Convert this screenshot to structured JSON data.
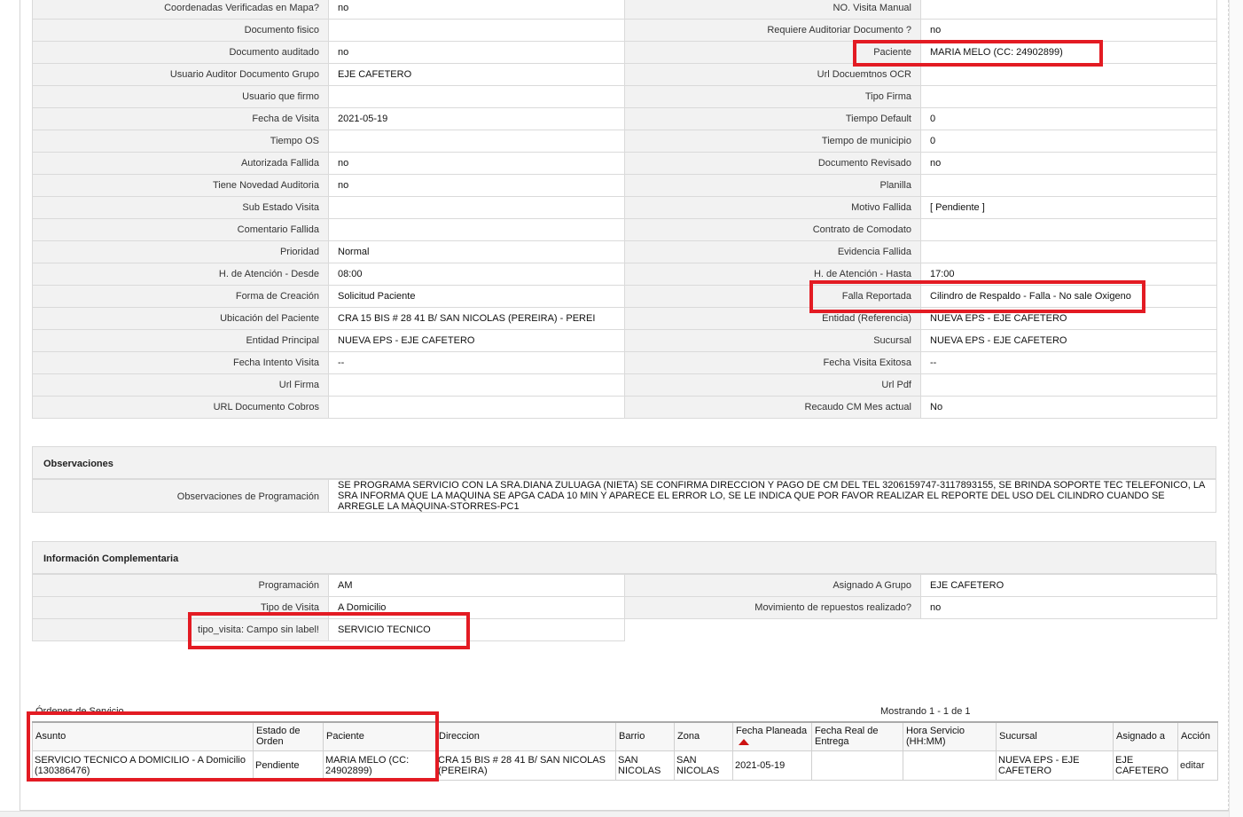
{
  "colors": {
    "highlight": "#e31b23",
    "label_bg": "#f2f2f2",
    "border": "#dadada"
  },
  "details": {
    "rows": [
      {
        "l1": "Coordenadas Verificadas en Mapa?",
        "v1": "no",
        "l2": "NO. Visita Manual",
        "v2": ""
      },
      {
        "l1": "Documento fisico",
        "v1": "",
        "l2": "Requiere Auditoriar Documento ?",
        "v2": "no"
      },
      {
        "l1": "Documento auditado",
        "v1": "no",
        "l2": "Paciente",
        "v2": "MARIA MELO (CC: 24902899)"
      },
      {
        "l1": "Usuario Auditor Documento Grupo",
        "v1": "EJE CAFETERO",
        "l2": "Url Docuemtnos OCR",
        "v2": ""
      },
      {
        "l1": "Usuario que firmo",
        "v1": "",
        "l2": "Tipo Firma",
        "v2": ""
      },
      {
        "l1": "Fecha de Visita",
        "v1": "2021-05-19",
        "l2": "Tiempo Default",
        "v2": "0"
      },
      {
        "l1": "Tiempo OS",
        "v1": "",
        "l2": "Tiempo de municipio",
        "v2": "0"
      },
      {
        "l1": "Autorizada Fallida",
        "v1": "no",
        "l2": "Documento Revisado",
        "v2": "no"
      },
      {
        "l1": "Tiene Novedad Auditoria",
        "v1": "no",
        "l2": "Planilla",
        "v2": ""
      },
      {
        "l1": "Sub Estado Visita",
        "v1": "",
        "l2": "Motivo Fallida",
        "v2": "[ Pendiente ]"
      },
      {
        "l1": "Comentario Fallida",
        "v1": "",
        "l2": "Contrato de Comodato",
        "v2": ""
      },
      {
        "l1": "Prioridad",
        "v1": "Normal",
        "l2": "Evidencia Fallida",
        "v2": ""
      },
      {
        "l1": "H. de Atención - Desde",
        "v1": "08:00",
        "l2": "H. de Atención - Hasta",
        "v2": "17:00"
      },
      {
        "l1": "Forma de Creación",
        "v1": "Solicitud Paciente",
        "l2": "Falla Reportada",
        "v2": "Cilindro de Respaldo - Falla - No sale Oxigeno"
      },
      {
        "l1": "Ubicación del Paciente",
        "v1": "CRA 15 BIS # 28 41 B/ SAN NICOLAS (PEREIRA) - PEREI",
        "l2": "Entidad (Referencia)",
        "v2": "NUEVA EPS - EJE CAFETERO"
      },
      {
        "l1": "Entidad Principal",
        "v1": "NUEVA EPS - EJE CAFETERO",
        "l2": "Sucursal",
        "v2": "NUEVA EPS - EJE CAFETERO"
      },
      {
        "l1": "Fecha Intento Visita",
        "v1": "--",
        "l2": "Fecha Visita Exitosa",
        "v2": "--"
      },
      {
        "l1": "Url Firma",
        "v1": "",
        "l2": "Url Pdf",
        "v2": ""
      },
      {
        "l1": "URL Documento Cobros",
        "v1": "",
        "l2": "Recaudo CM Mes actual",
        "v2": "No"
      }
    ]
  },
  "observaciones": {
    "title": "Observaciones",
    "label": "Observaciones de Programación",
    "value": "   SE PROGRAMA SERVICIO CON LA SRA.DIANA ZULUAGA (NIETA) SE CONFIRMA DIRECCION Y PAGO DE CM DEL TEL 3206159747-3117893155, SE BRINDA SOPORTE TEC TELEFONICO, LA SRA INFORMA QUE LA MAQUINA SE APGA CADA 10 MIN Y APARECE EL ERROR LO, SE LE INDICA QUE POR FAVOR REALIZAR EL REPORTE DEL USO DEL CILINDRO CUANDO SE ARREGLE LA MAQUINA-STORRES-PC1"
  },
  "complementaria": {
    "title": "Información Complementaria",
    "rows": [
      {
        "l1": "Programación",
        "v1": "AM",
        "l2": "Asignado A Grupo",
        "v2": "EJE CAFETERO"
      },
      {
        "l1": "Tipo de Visita",
        "v1": "A Domicilio",
        "l2": "Movimiento de repuestos realizado?",
        "v2": "no"
      },
      {
        "l1": "tipo_visita: Campo sin label!",
        "v1": "SERVICIO TECNICO"
      }
    ]
  },
  "ordenes": {
    "caption": "Órdenes de Servicio",
    "count_text": "Mostrando 1 - 1 de 1",
    "headers": [
      "Asunto",
      "Estado de Orden",
      "Paciente",
      "Direccion",
      "Barrio",
      "Zona",
      "Fecha Planeada",
      "Fecha Real de Entrega",
      "Hora Servicio (HH:MM)",
      "Sucursal",
      "Asignado a",
      "Acción"
    ],
    "rows": [
      [
        "SERVICIO TECNICO A DOMICILIO - A Domicilio (130386476)",
        "Pendiente",
        "MARIA MELO (CC: 24902899)",
        "CRA 15 BIS # 28 41 B/ SAN NICOLAS (PEREIRA)",
        "SAN NICOLAS",
        "SAN NICOLAS",
        "2021-05-19",
        "",
        "",
        "NUEVA EPS - EJE CAFETERO",
        "EJE CAFETERO",
        "editar"
      ]
    ]
  }
}
